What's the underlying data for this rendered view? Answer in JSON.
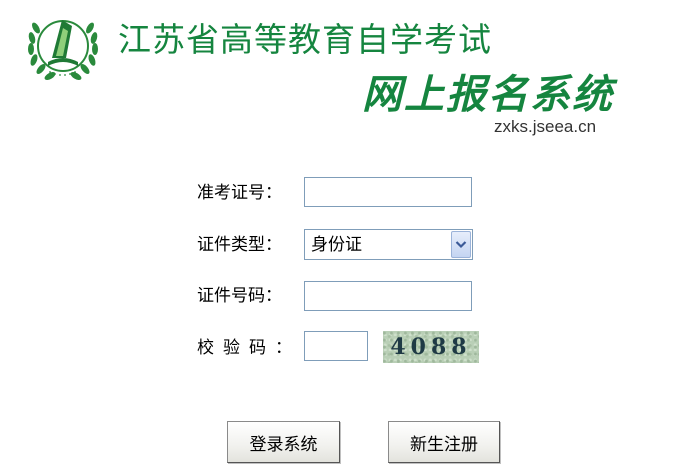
{
  "header": {
    "title_main": "江苏省高等教育自学考试",
    "title_sub": "网上报名系统",
    "site_url": "zxks.jseea.cn",
    "logo_icon": "green-laurel-emblem-icon"
  },
  "form": {
    "exam_number_label": "准考证号：",
    "exam_number_value": "",
    "id_type_label": "证件类型：",
    "id_type_selected": "身份证",
    "id_number_label": "证件号码：",
    "id_number_value": "",
    "captcha_label": "校验码：",
    "captcha_value": "",
    "captcha_code": "4088"
  },
  "buttons": {
    "login_label": "登录系统",
    "register_label": "新生注册"
  },
  "colors": {
    "brand_green": "#15853f",
    "input_border": "#7f9db9"
  }
}
